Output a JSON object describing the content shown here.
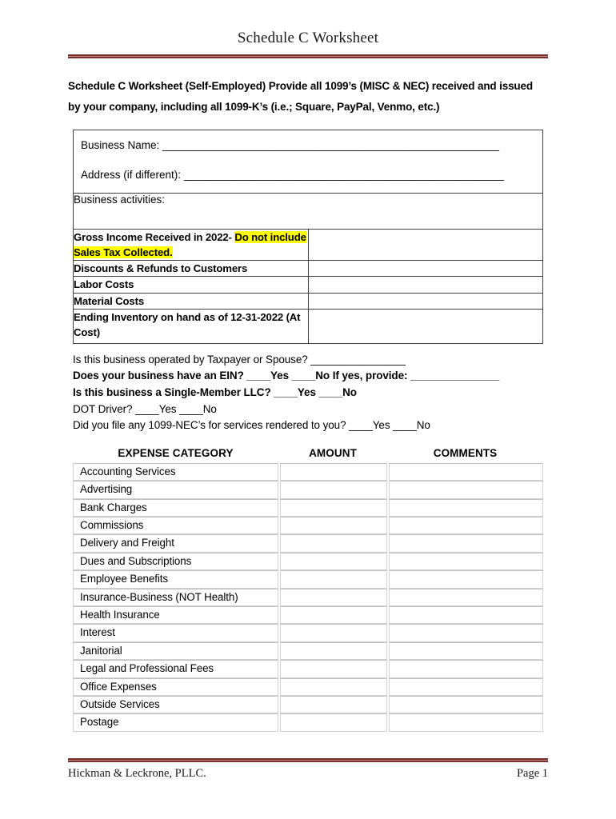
{
  "document": {
    "title": "Schedule C Worksheet",
    "intro": "Schedule C Worksheet (Self-Employed) Provide all 1099’s (MISC & NEC) received and issued by your company, including all 1099-K’s (i.e.; Square, PayPal, Venmo, etc.)",
    "accent_color": "#7b2f2c",
    "highlight_color": "#ffff00"
  },
  "info_table": {
    "business_name_label": "Business Name:",
    "business_name_blank": "____________________________________________________________",
    "address_label": "Address (if different):",
    "address_blank": "_________________________________________________________",
    "activities_label": "Business activities:",
    "rows": [
      {
        "label_before": "Gross Income Received in 2022-",
        "label_highlight": "Do not include Sales Tax Collected.",
        "value": ""
      },
      {
        "label": "Discounts & Refunds to Customers",
        "value": ""
      },
      {
        "label": "Labor Costs",
        "value": ""
      },
      {
        "label": "Material Costs",
        "value": ""
      },
      {
        "label": "Ending Inventory on hand as of 12-31-2022 (At Cost)",
        "value": ""
      }
    ]
  },
  "questions": [
    {
      "text": "Is this business operated by Taxpayer or Spouse? ________________",
      "bold": false
    },
    {
      "text": "Does your business have an EIN? ____Yes   ____No If yes, provide: _______________",
      "bold": true
    },
    {
      "text": "Is this business a Single-Member LLC? ____Yes   ____No",
      "bold": true
    },
    {
      "text": "DOT Driver? ____Yes   ____No",
      "bold": false
    },
    {
      "text": "Did you file any 1099-NEC’s for services rendered to you? ____Yes   ____No",
      "bold": false
    }
  ],
  "expense_table": {
    "headers": [
      "EXPENSE CATEGORY",
      "AMOUNT",
      "COMMENTS"
    ],
    "rows": [
      {
        "category": "Accounting Services",
        "amount": "",
        "comments": ""
      },
      {
        "category": "Advertising",
        "amount": "",
        "comments": ""
      },
      {
        "category": "Bank Charges",
        "amount": "",
        "comments": ""
      },
      {
        "category": "Commissions",
        "amount": "",
        "comments": ""
      },
      {
        "category": "Delivery and Freight",
        "amount": "",
        "comments": ""
      },
      {
        "category": "Dues and Subscriptions",
        "amount": "",
        "comments": ""
      },
      {
        "category": "Employee Benefits",
        "amount": "",
        "comments": ""
      },
      {
        "category": "Insurance-Business (NOT Health)",
        "amount": "",
        "comments": ""
      },
      {
        "category": "Health Insurance",
        "amount": "",
        "comments": ""
      },
      {
        "category": "Interest",
        "amount": "",
        "comments": ""
      },
      {
        "category": "Janitorial",
        "amount": "",
        "comments": ""
      },
      {
        "category": "Legal and Professional Fees",
        "amount": "",
        "comments": ""
      },
      {
        "category": "Office Expenses",
        "amount": "",
        "comments": ""
      },
      {
        "category": "Outside Services",
        "amount": "",
        "comments": ""
      },
      {
        "category": "Postage",
        "amount": "",
        "comments": ""
      }
    ]
  },
  "footer": {
    "firm": "Hickman & Leckrone, PLLC.",
    "page": "Page 1"
  }
}
